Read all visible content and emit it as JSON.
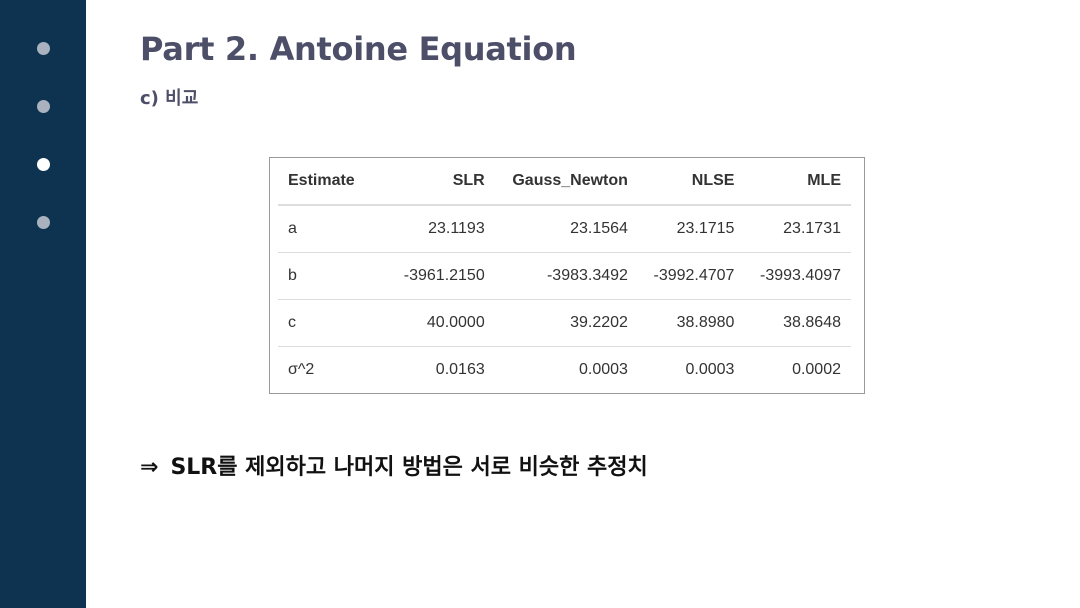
{
  "slide": {
    "title": "Part 2. Antoine Equation",
    "subtitle": "c) 비교",
    "nav_dots": [
      {
        "active": false
      },
      {
        "active": false
      },
      {
        "active": true
      },
      {
        "active": false
      }
    ]
  },
  "table": {
    "headers": [
      "Estimate",
      "SLR",
      "Gauss_Newton",
      "NLSE",
      "MLE"
    ],
    "rows": [
      [
        "a",
        "23.1193",
        "23.1564",
        "23.1715",
        "23.1731"
      ],
      [
        "b",
        "-3961.2150",
        "-3983.3492",
        "-3992.4707",
        "-3993.4097"
      ],
      [
        "c",
        "40.0000",
        "39.2202",
        "38.8980",
        "38.8648"
      ],
      [
        "σ^2",
        "0.0163",
        "0.0003",
        "0.0003",
        "0.0002"
      ]
    ]
  },
  "conclusion": {
    "arrow": "⇒",
    "text": "SLR를 제외하고 나머지 방법은 서로 비슷한 추정치"
  },
  "colors": {
    "sidebar": "#0d3350",
    "title": "#4d4f69",
    "dot_inactive": "#a9b2be",
    "dot_active": "#ffffff"
  }
}
